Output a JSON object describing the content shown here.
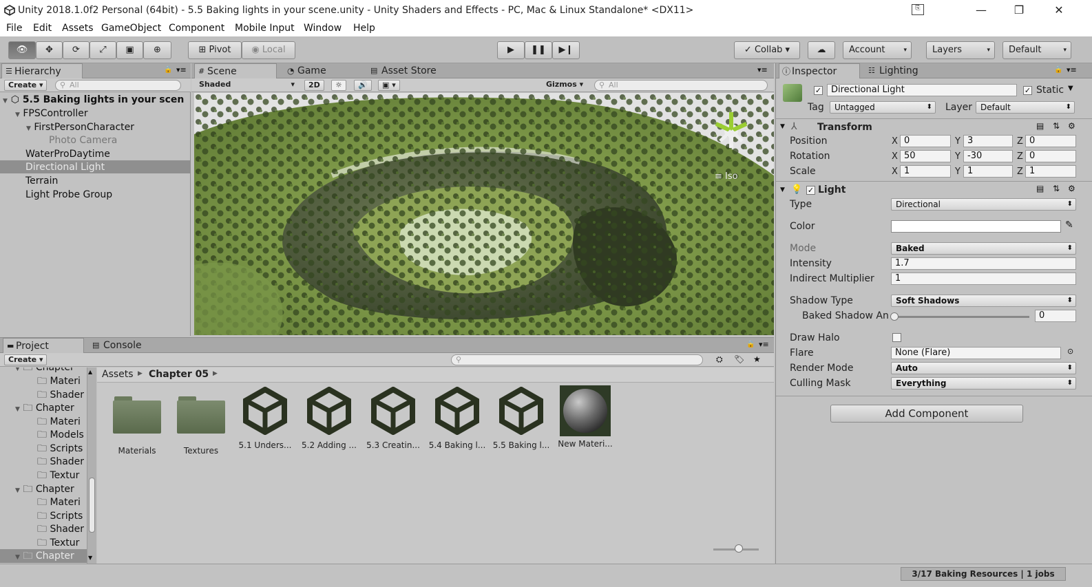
{
  "window": {
    "title": "Unity 2018.1.0f2 Personal (64bit) - 5.5 Baking lights in your scene.unity - Unity Shaders and Effects - PC, Mac & Linux Standalone* <DX11>",
    "min": "—",
    "max": "❐",
    "close": "✕"
  },
  "menu": [
    "File",
    "Edit",
    "Assets",
    "GameObject",
    "Component",
    "Mobile Input",
    "Window",
    "Help"
  ],
  "toolbar": {
    "pivot": "Pivot",
    "local": "Local",
    "collab": "Collab ▾",
    "account": "Account",
    "layers": "Layers",
    "layout": "Default"
  },
  "hierarchy": {
    "tab": "Hierarchy",
    "create": "Create",
    "search_placeholder": "All",
    "scene_name": "5.5 Baking lights in your scen",
    "items": [
      "FPSController",
      "FirstPersonCharacter",
      "Photo Camera",
      "WaterProDaytime",
      "Directional Light",
      "Terrain",
      "Light Probe Group"
    ]
  },
  "scene": {
    "tabs": [
      "Scene",
      "Game",
      "Asset Store"
    ],
    "shading": "Shaded",
    "mode_2d": "2D",
    "gizmos": "Gizmos",
    "search_placeholder": "All",
    "iso": "Iso"
  },
  "inspector": {
    "tabs": [
      "Inspector",
      "Lighting"
    ],
    "object_name": "Directional Light",
    "static": "Static",
    "tag_label": "Tag",
    "tag": "Untagged",
    "layer_label": "Layer",
    "layer": "Default",
    "transform": {
      "title": "Transform",
      "position_label": "Position",
      "rotation_label": "Rotation",
      "scale_label": "Scale",
      "position": [
        "0",
        "3",
        "0"
      ],
      "rotation": [
        "50",
        "-30",
        "0"
      ],
      "scale": [
        "1",
        "1",
        "1"
      ]
    },
    "light": {
      "title": "Light",
      "type_label": "Type",
      "type": "Directional",
      "color_label": "Color",
      "mode_label": "Mode",
      "mode": "Baked",
      "intensity_label": "Intensity",
      "intensity": "1.7",
      "indirect_label": "Indirect Multiplier",
      "indirect": "1",
      "shadow_type_label": "Shadow Type",
      "shadow_type": "Soft Shadows",
      "baked_shadow_label": "Baked Shadow An",
      "baked_shadow": "0",
      "draw_halo_label": "Draw Halo",
      "flare_label": "Flare",
      "flare": "None (Flare)",
      "render_mode_label": "Render Mode",
      "render_mode": "Auto",
      "culling_label": "Culling Mask",
      "culling": "Everything"
    },
    "add_component": "Add Component"
  },
  "project": {
    "tabs": [
      "Project",
      "Console"
    ],
    "create": "Create",
    "breadcrumb_root": "Assets",
    "breadcrumb_current": "Chapter 05",
    "tree": [
      "Chapter",
      "Materi",
      "Shader",
      "Chapter",
      "Materi",
      "Models",
      "Scripts",
      "Shader",
      "Textur",
      "Chapter",
      "Materi",
      "Scripts",
      "Shader",
      "Textur",
      "Chapter"
    ],
    "assets": [
      "Materials",
      "Textures",
      "5.1 Unders...",
      "5.2 Adding ...",
      "5.3 Creatin...",
      "5.4 Baking l...",
      "5.5 Baking l...",
      "New Materi..."
    ]
  },
  "status": "3/17 Baking Resources | 1 jobs",
  "colors": {
    "selection": "#8f8f8f",
    "panel": "#c2c2c2",
    "tabstrip": "#a8a8a8"
  }
}
